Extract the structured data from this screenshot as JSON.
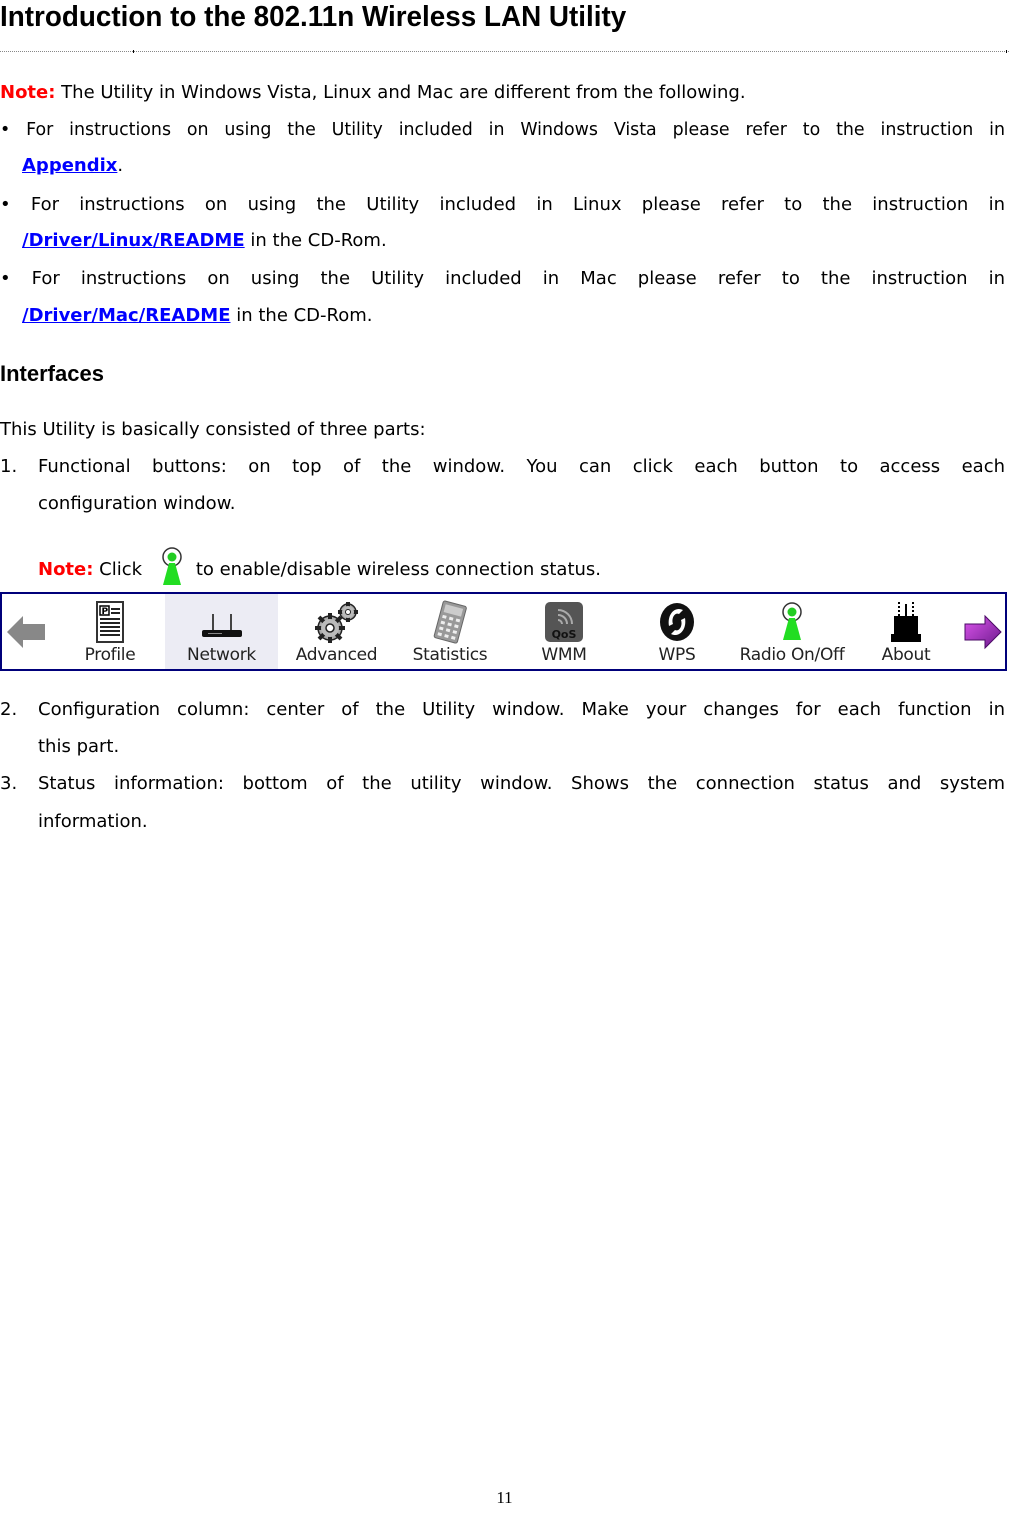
{
  "title": "Introduction to the 802.11n Wireless LAN Utility",
  "note1": {
    "label": "Note:",
    "text": " The Utility in Windows Vista, Linux and Mac are different from the following."
  },
  "bullets": [
    {
      "text": "• For instructions on using the Utility included in Windows Vista please refer to the instruction in",
      "link": "Appendix",
      "after": "."
    },
    {
      "text": "• For instructions on using the Utility included in Linux please refer to the instruction in",
      "link": "/Driver/Linux/README",
      "after": " in the CD-Rom."
    },
    {
      "text": "• For instructions on using the Utility included in Mac please refer to the instruction in",
      "link": "/Driver/Mac/README",
      "after": " in the CD-Rom."
    }
  ],
  "section_heading": "Interfaces",
  "intro": "This Utility is basically consisted of three parts:",
  "list": [
    {
      "num": "1.",
      "line1": "Functional buttons: on top of the window. You can click each button to access each",
      "line2": "configuration window."
    },
    {
      "num": "2.",
      "line1": "Configuration column: center of the Utility window. Make your changes for each function in",
      "line2": "this part."
    },
    {
      "num": "3.",
      "line1": "Status information: bottom of the utility window. Shows the connection status and system",
      "line2": "information."
    }
  ],
  "note2": {
    "label": "Note:",
    "before": " Click",
    "icon": "radio-antenna-icon",
    "after": "to enable/disable wireless connection status."
  },
  "toolbar": {
    "active": "Network",
    "items": [
      {
        "label": "",
        "icon": "back-arrow-icon"
      },
      {
        "label": "Profile",
        "icon": "profile-icon"
      },
      {
        "label": "Network",
        "icon": "router-icon"
      },
      {
        "label": "Advanced",
        "icon": "gears-icon"
      },
      {
        "label": "Statistics",
        "icon": "calculator-icon"
      },
      {
        "label": "WMM",
        "icon": "qos-icon"
      },
      {
        "label": "WPS",
        "icon": "wps-icon"
      },
      {
        "label": "Radio On/Off",
        "icon": "radio-antenna-icon"
      },
      {
        "label": "About",
        "icon": "about-device-icon"
      },
      {
        "label": "",
        "icon": "forward-arrow-icon"
      }
    ]
  },
  "colors": {
    "note": "#ff0000",
    "link": "#0000ff",
    "toolbar_border": "#00007a"
  },
  "page_number": "11"
}
